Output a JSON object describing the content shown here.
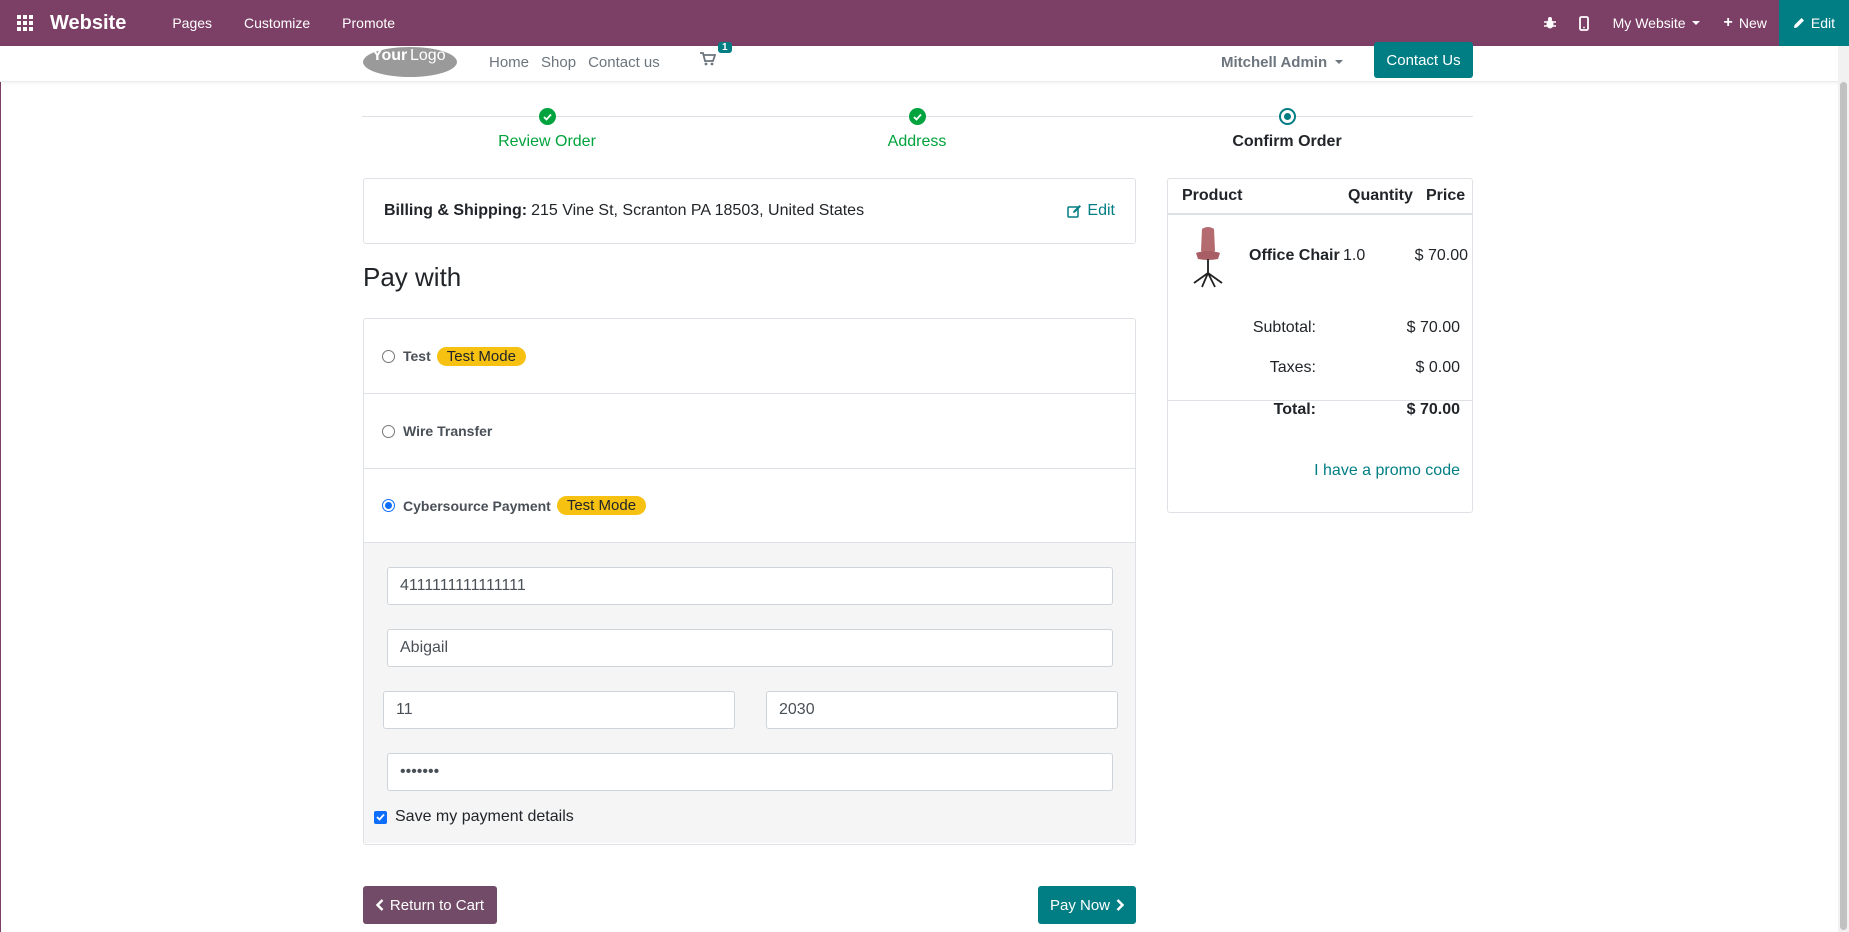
{
  "topbar": {
    "brand": "Website",
    "nav": [
      "Pages",
      "Customize",
      "Promote"
    ],
    "my_website": "My Website",
    "new": "New",
    "edit": "Edit"
  },
  "header": {
    "logo_text": "Your Logo",
    "links": [
      "Home",
      "Shop",
      "Contact us"
    ],
    "cart_count": "1",
    "user": "Mitchell Admin",
    "contact_button": "Contact Us"
  },
  "progress": {
    "steps": [
      {
        "label": "Review Order",
        "state": "done"
      },
      {
        "label": "Address",
        "state": "done"
      },
      {
        "label": "Confirm Order",
        "state": "current"
      }
    ]
  },
  "billing": {
    "label": "Billing & Shipping:",
    "address": "215 Vine St, Scranton PA 18503, United States",
    "edit": "Edit"
  },
  "pay_with_title": "Pay with",
  "payment_options": [
    {
      "name": "Test",
      "badge": "Test Mode",
      "selected": false
    },
    {
      "name": "Wire Transfer",
      "badge": "",
      "selected": false
    },
    {
      "name": "Cybersource Payment",
      "badge": "Test Mode",
      "selected": true
    }
  ],
  "card_form": {
    "card_number": "4111111111111111",
    "name": "Abigail",
    "month": "11",
    "year": "2030",
    "cvc": "•••••••",
    "save_label": "Save my payment details"
  },
  "buttons": {
    "return": "Return to Cart",
    "pay": "Pay Now"
  },
  "summary": {
    "headers": [
      "Product",
      "Quantity",
      "Price"
    ],
    "product": {
      "name": "Office Chair",
      "qty": "1.0",
      "price": "$ 70.00"
    },
    "subtotal_label": "Subtotal:",
    "subtotal": "$ 70.00",
    "taxes_label": "Taxes:",
    "taxes": "$ 0.00",
    "total_label": "Total:",
    "total": "$ 70.00",
    "promo": "I have a promo code"
  },
  "colors": {
    "topbar": "#7c3f66",
    "primary": "#017e84",
    "success": "#00a33d",
    "badge": "#f7c112",
    "return_button": "#714b67"
  }
}
